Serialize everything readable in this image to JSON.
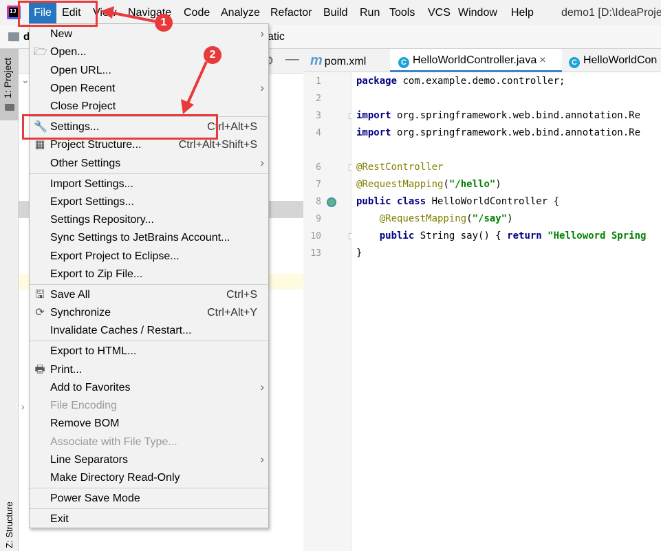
{
  "menubar": {
    "items": [
      "File",
      "Edit",
      "View",
      "Navigate",
      "Code",
      "Analyze",
      "Refactor",
      "Build",
      "Run",
      "Tools",
      "VCS",
      "Window",
      "Help"
    ],
    "window_title": "demo1 [D:\\IdeaProje"
  },
  "navbar": {
    "first": "d",
    "tail": "atic"
  },
  "tool_windows": {
    "project": "1: Project",
    "structure": "Z: Structure"
  },
  "editor": {
    "tabs": [
      "pom.xml",
      "HelloWorldController.java",
      "HelloWorldCon"
    ],
    "line_numbers": [
      "1",
      "2",
      "3",
      "4",
      "6",
      "7",
      "8",
      "9",
      "10",
      "13"
    ],
    "code": {
      "l1_kw": "package",
      "l1_rest": " com.example.demo.controller;",
      "l3_kw": "import",
      "l3_rest": " org.springframework.web.bind.annotation.Re",
      "l4_kw": "import",
      "l4_rest": " org.springframework.web.bind.annotation.Re",
      "l6_ann": "@RestController",
      "l7_ann": "@RequestMapping",
      "l7_p1": "(",
      "l7_str": "\"/hello\"",
      "l7_p2": ")",
      "l8_kw": "public class",
      "l8_rest": " HelloWorldController {",
      "l9_ann": "    @RequestMapping",
      "l9_p1": "(",
      "l9_str": "\"/say\"",
      "l9_p2": ")",
      "l10_kw1": "    public",
      "l10_mid": " String say() { ",
      "l10_kw2": "return",
      "l10_str": " \"Helloword Spring",
      "l13": "}"
    }
  },
  "file_menu": {
    "items": [
      {
        "label": "New",
        "submenu": true
      },
      {
        "label": "Open...",
        "icon": "folder-open-icon"
      },
      {
        "label": "Open URL..."
      },
      {
        "label": "Open Recent",
        "submenu": true
      },
      {
        "label": "Close Project"
      },
      {
        "label": "Settings...",
        "shortcut": "Ctrl+Alt+S",
        "icon": "wrench-icon"
      },
      {
        "label": "Project Structure...",
        "shortcut": "Ctrl+Alt+Shift+S",
        "icon": "project-structure-icon"
      },
      {
        "label": "Other Settings",
        "submenu": true
      },
      {
        "label": "Import Settings..."
      },
      {
        "label": "Export Settings..."
      },
      {
        "label": "Settings Repository..."
      },
      {
        "label": "Sync Settings to JetBrains Account..."
      },
      {
        "label": "Export Project to Eclipse..."
      },
      {
        "label": "Export to Zip File..."
      },
      {
        "label": "Save All",
        "shortcut": "Ctrl+S",
        "icon": "save-icon"
      },
      {
        "label": "Synchronize",
        "shortcut": "Ctrl+Alt+Y",
        "icon": "sync-icon"
      },
      {
        "label": "Invalidate Caches / Restart..."
      },
      {
        "label": "Export to HTML..."
      },
      {
        "label": "Print...",
        "icon": "printer-icon"
      },
      {
        "label": "Add to Favorites",
        "submenu": true
      },
      {
        "label": "File Encoding",
        "disabled": true
      },
      {
        "label": "Remove BOM"
      },
      {
        "label": "Associate with File Type...",
        "disabled": true
      },
      {
        "label": "Line Separators",
        "submenu": true
      },
      {
        "label": "Make Directory Read-Only"
      },
      {
        "label": "Power Save Mode"
      },
      {
        "label": "Exit"
      }
    ]
  },
  "annotations": {
    "badge1": "1",
    "badge2": "2",
    "color": "#e83a3a"
  }
}
